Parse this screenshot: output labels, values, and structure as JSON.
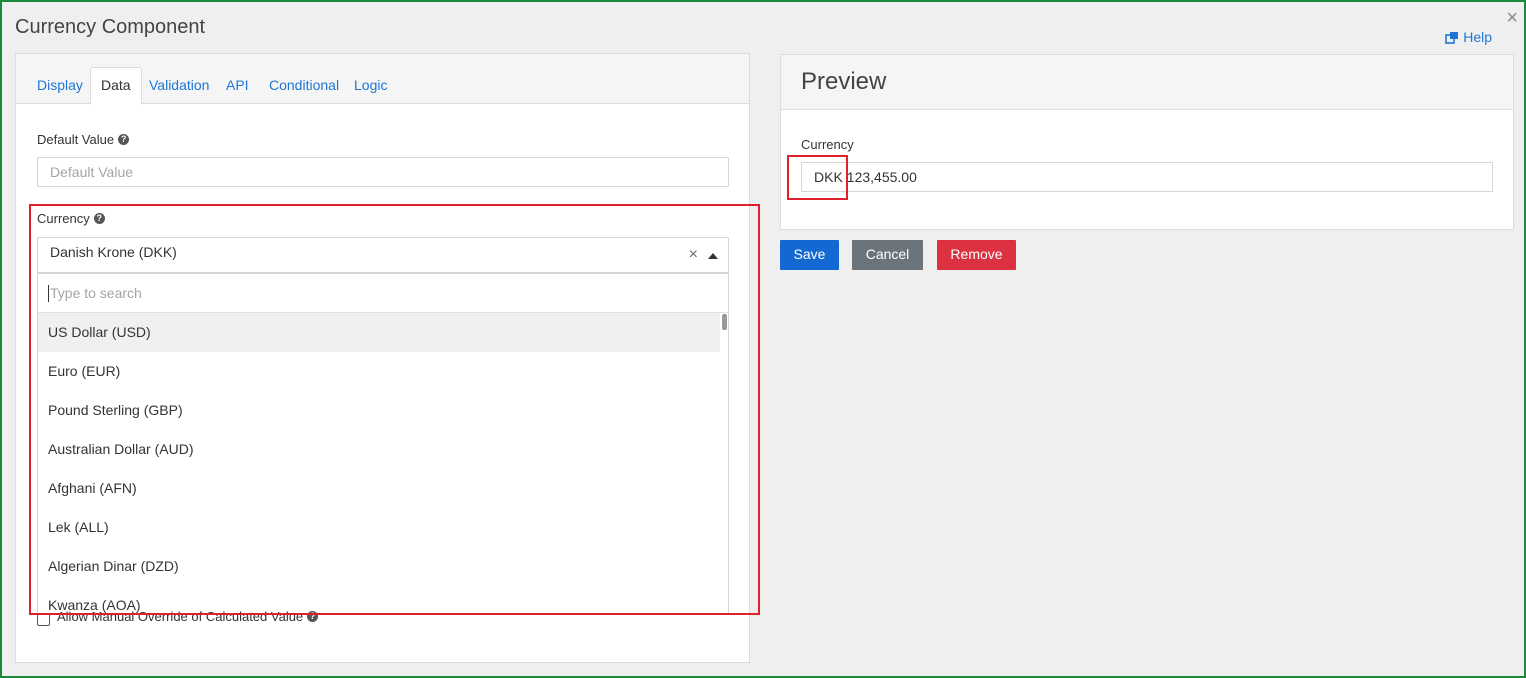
{
  "dialog": {
    "title": "Currency Component",
    "close_label": "×",
    "help_label": "Help"
  },
  "tabs": [
    {
      "label": "Display"
    },
    {
      "label": "Data"
    },
    {
      "label": "Validation"
    },
    {
      "label": "API"
    },
    {
      "label": "Conditional"
    },
    {
      "label": "Logic"
    }
  ],
  "default_value": {
    "label": "Default Value",
    "placeholder": "Default Value",
    "help_icon": "question-circle-icon"
  },
  "currency_select": {
    "label": "Currency",
    "selected": "Danish Krone (DKK)",
    "clear_label": "×",
    "search_placeholder": "Type to search",
    "options": [
      "US Dollar (USD)",
      "Euro (EUR)",
      "Pound Sterling (GBP)",
      "Australian Dollar (AUD)",
      "Afghani (AFN)",
      "Lek (ALL)",
      "Algerian Dinar (DZD)",
      "Kwanza (AOA)"
    ],
    "highlighted_index": 0
  },
  "manual_override": {
    "label": "Allow Manual Override of Calculated Value",
    "checked": false
  },
  "preview": {
    "title": "Preview",
    "field_label": "Currency",
    "prefix": "DKK",
    "value": "123,455.00"
  },
  "buttons": {
    "save": "Save",
    "cancel": "Cancel",
    "remove": "Remove"
  },
  "colors": {
    "link": "#1f75d6",
    "save": "#1468d2",
    "cancel": "#6b737b",
    "remove": "#dc3140",
    "highlight_box": "#e0202a",
    "window_border": "#1a8a3a"
  }
}
